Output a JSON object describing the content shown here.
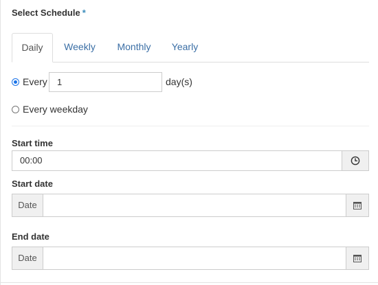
{
  "form": {
    "title": "Select Schedule",
    "required_marker": "*"
  },
  "tabs": [
    {
      "label": "Daily",
      "active": true
    },
    {
      "label": "Weekly",
      "active": false
    },
    {
      "label": "Monthly",
      "active": false
    },
    {
      "label": "Yearly",
      "active": false
    }
  ],
  "daily": {
    "every_option": {
      "label": "Every",
      "checked": true,
      "value": "1",
      "suffix": "day(s)"
    },
    "weekday_option": {
      "label": "Every weekday",
      "checked": false
    }
  },
  "start_time": {
    "label": "Start time",
    "value": "00:00",
    "icon": "clock-icon"
  },
  "start_date": {
    "label": "Start date",
    "prefix": "Date",
    "value": "",
    "icon": "calendar-icon"
  },
  "end_date": {
    "label": "End date",
    "prefix": "Date",
    "value": "",
    "icon": "calendar-icon"
  },
  "colors": {
    "accent": "#1a73e8",
    "link": "#3a6ea5",
    "required": "#3c8dbc"
  }
}
